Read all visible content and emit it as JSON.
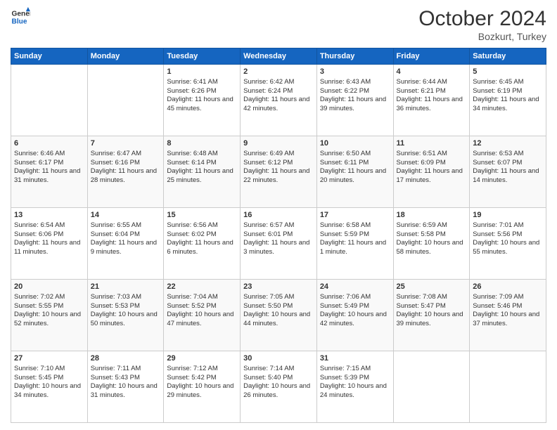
{
  "header": {
    "logo_line1": "General",
    "logo_line2": "Blue",
    "month": "October 2024",
    "location": "Bozkurt, Turkey"
  },
  "weekdays": [
    "Sunday",
    "Monday",
    "Tuesday",
    "Wednesday",
    "Thursday",
    "Friday",
    "Saturday"
  ],
  "weeks": [
    [
      {
        "day": "",
        "sunrise": "",
        "sunset": "",
        "daylight": ""
      },
      {
        "day": "",
        "sunrise": "",
        "sunset": "",
        "daylight": ""
      },
      {
        "day": "1",
        "sunrise": "Sunrise: 6:41 AM",
        "sunset": "Sunset: 6:26 PM",
        "daylight": "Daylight: 11 hours and 45 minutes."
      },
      {
        "day": "2",
        "sunrise": "Sunrise: 6:42 AM",
        "sunset": "Sunset: 6:24 PM",
        "daylight": "Daylight: 11 hours and 42 minutes."
      },
      {
        "day": "3",
        "sunrise": "Sunrise: 6:43 AM",
        "sunset": "Sunset: 6:22 PM",
        "daylight": "Daylight: 11 hours and 39 minutes."
      },
      {
        "day": "4",
        "sunrise": "Sunrise: 6:44 AM",
        "sunset": "Sunset: 6:21 PM",
        "daylight": "Daylight: 11 hours and 36 minutes."
      },
      {
        "day": "5",
        "sunrise": "Sunrise: 6:45 AM",
        "sunset": "Sunset: 6:19 PM",
        "daylight": "Daylight: 11 hours and 34 minutes."
      }
    ],
    [
      {
        "day": "6",
        "sunrise": "Sunrise: 6:46 AM",
        "sunset": "Sunset: 6:17 PM",
        "daylight": "Daylight: 11 hours and 31 minutes."
      },
      {
        "day": "7",
        "sunrise": "Sunrise: 6:47 AM",
        "sunset": "Sunset: 6:16 PM",
        "daylight": "Daylight: 11 hours and 28 minutes."
      },
      {
        "day": "8",
        "sunrise": "Sunrise: 6:48 AM",
        "sunset": "Sunset: 6:14 PM",
        "daylight": "Daylight: 11 hours and 25 minutes."
      },
      {
        "day": "9",
        "sunrise": "Sunrise: 6:49 AM",
        "sunset": "Sunset: 6:12 PM",
        "daylight": "Daylight: 11 hours and 22 minutes."
      },
      {
        "day": "10",
        "sunrise": "Sunrise: 6:50 AM",
        "sunset": "Sunset: 6:11 PM",
        "daylight": "Daylight: 11 hours and 20 minutes."
      },
      {
        "day": "11",
        "sunrise": "Sunrise: 6:51 AM",
        "sunset": "Sunset: 6:09 PM",
        "daylight": "Daylight: 11 hours and 17 minutes."
      },
      {
        "day": "12",
        "sunrise": "Sunrise: 6:53 AM",
        "sunset": "Sunset: 6:07 PM",
        "daylight": "Daylight: 11 hours and 14 minutes."
      }
    ],
    [
      {
        "day": "13",
        "sunrise": "Sunrise: 6:54 AM",
        "sunset": "Sunset: 6:06 PM",
        "daylight": "Daylight: 11 hours and 11 minutes."
      },
      {
        "day": "14",
        "sunrise": "Sunrise: 6:55 AM",
        "sunset": "Sunset: 6:04 PM",
        "daylight": "Daylight: 11 hours and 9 minutes."
      },
      {
        "day": "15",
        "sunrise": "Sunrise: 6:56 AM",
        "sunset": "Sunset: 6:02 PM",
        "daylight": "Daylight: 11 hours and 6 minutes."
      },
      {
        "day": "16",
        "sunrise": "Sunrise: 6:57 AM",
        "sunset": "Sunset: 6:01 PM",
        "daylight": "Daylight: 11 hours and 3 minutes."
      },
      {
        "day": "17",
        "sunrise": "Sunrise: 6:58 AM",
        "sunset": "Sunset: 5:59 PM",
        "daylight": "Daylight: 11 hours and 1 minute."
      },
      {
        "day": "18",
        "sunrise": "Sunrise: 6:59 AM",
        "sunset": "Sunset: 5:58 PM",
        "daylight": "Daylight: 10 hours and 58 minutes."
      },
      {
        "day": "19",
        "sunrise": "Sunrise: 7:01 AM",
        "sunset": "Sunset: 5:56 PM",
        "daylight": "Daylight: 10 hours and 55 minutes."
      }
    ],
    [
      {
        "day": "20",
        "sunrise": "Sunrise: 7:02 AM",
        "sunset": "Sunset: 5:55 PM",
        "daylight": "Daylight: 10 hours and 52 minutes."
      },
      {
        "day": "21",
        "sunrise": "Sunrise: 7:03 AM",
        "sunset": "Sunset: 5:53 PM",
        "daylight": "Daylight: 10 hours and 50 minutes."
      },
      {
        "day": "22",
        "sunrise": "Sunrise: 7:04 AM",
        "sunset": "Sunset: 5:52 PM",
        "daylight": "Daylight: 10 hours and 47 minutes."
      },
      {
        "day": "23",
        "sunrise": "Sunrise: 7:05 AM",
        "sunset": "Sunset: 5:50 PM",
        "daylight": "Daylight: 10 hours and 44 minutes."
      },
      {
        "day": "24",
        "sunrise": "Sunrise: 7:06 AM",
        "sunset": "Sunset: 5:49 PM",
        "daylight": "Daylight: 10 hours and 42 minutes."
      },
      {
        "day": "25",
        "sunrise": "Sunrise: 7:08 AM",
        "sunset": "Sunset: 5:47 PM",
        "daylight": "Daylight: 10 hours and 39 minutes."
      },
      {
        "day": "26",
        "sunrise": "Sunrise: 7:09 AM",
        "sunset": "Sunset: 5:46 PM",
        "daylight": "Daylight: 10 hours and 37 minutes."
      }
    ],
    [
      {
        "day": "27",
        "sunrise": "Sunrise: 7:10 AM",
        "sunset": "Sunset: 5:45 PM",
        "daylight": "Daylight: 10 hours and 34 minutes."
      },
      {
        "day": "28",
        "sunrise": "Sunrise: 7:11 AM",
        "sunset": "Sunset: 5:43 PM",
        "daylight": "Daylight: 10 hours and 31 minutes."
      },
      {
        "day": "29",
        "sunrise": "Sunrise: 7:12 AM",
        "sunset": "Sunset: 5:42 PM",
        "daylight": "Daylight: 10 hours and 29 minutes."
      },
      {
        "day": "30",
        "sunrise": "Sunrise: 7:14 AM",
        "sunset": "Sunset: 5:40 PM",
        "daylight": "Daylight: 10 hours and 26 minutes."
      },
      {
        "day": "31",
        "sunrise": "Sunrise: 7:15 AM",
        "sunset": "Sunset: 5:39 PM",
        "daylight": "Daylight: 10 hours and 24 minutes."
      },
      {
        "day": "",
        "sunrise": "",
        "sunset": "",
        "daylight": ""
      },
      {
        "day": "",
        "sunrise": "",
        "sunset": "",
        "daylight": ""
      }
    ]
  ]
}
